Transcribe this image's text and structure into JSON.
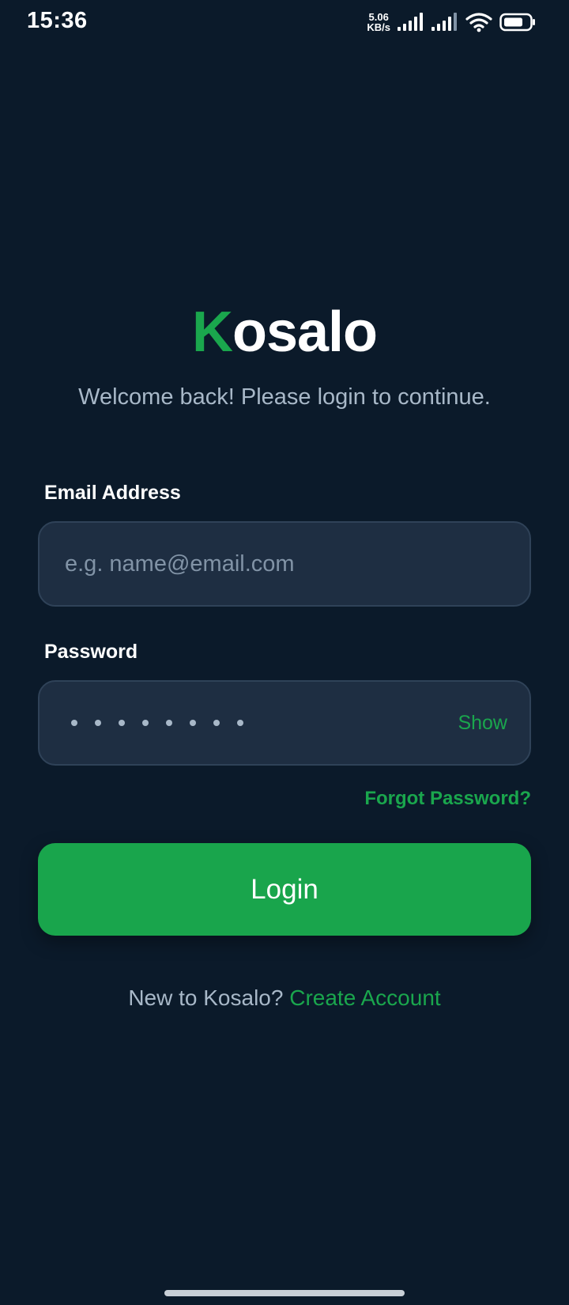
{
  "status_bar": {
    "time": "15:36",
    "net_speed_value": "5.06",
    "net_speed_unit": "KB/s",
    "icons": [
      "signal-icon",
      "signal-icon",
      "wifi-icon",
      "battery-icon"
    ]
  },
  "brand": {
    "initial": "K",
    "rest": "osalo"
  },
  "subtitle": "Welcome back! Please login to continue.",
  "form": {
    "email_label": "Email Address",
    "email_placeholder": "e.g. name@email.com",
    "email_value": "",
    "password_label": "Password",
    "password_value_masked": "••••••••",
    "show_label": "Show",
    "forgot_label": "Forgot Password?",
    "login_label": "Login"
  },
  "signup": {
    "prompt": "New to Kosalo?",
    "link": "Create Account"
  },
  "colors": {
    "background": "#0b1a2a",
    "accent": "#1aa64d",
    "field_bg": "#1e2e42",
    "muted_text": "#a8b8c8"
  }
}
